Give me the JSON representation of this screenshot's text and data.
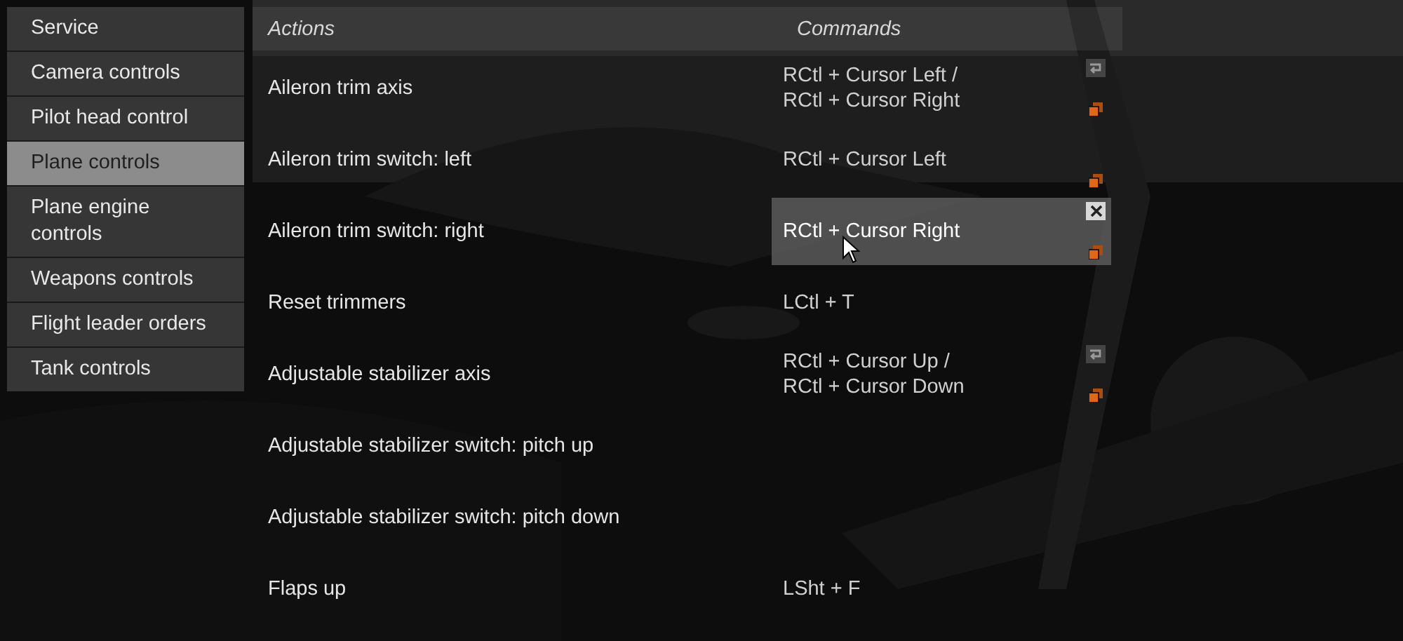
{
  "sidebar": {
    "items": [
      {
        "label": "Service",
        "selected": false
      },
      {
        "label": "Camera controls",
        "selected": false
      },
      {
        "label": "Pilot head control",
        "selected": false
      },
      {
        "label": "Plane controls",
        "selected": true
      },
      {
        "label": "Plane engine controls",
        "selected": false
      },
      {
        "label": "Weapons controls",
        "selected": false
      },
      {
        "label": "Flight leader orders",
        "selected": false
      },
      {
        "label": "Tank controls",
        "selected": false
      }
    ]
  },
  "table": {
    "columns": [
      "Actions",
      "Commands"
    ],
    "rows": [
      {
        "action": "Aileron trim axis",
        "command": "RCtl + Cursor Left /\nRCtl + Cursor Right",
        "axis": true,
        "copy": true,
        "hovered": false
      },
      {
        "action": "Aileron trim switch: left",
        "command": "RCtl + Cursor Left",
        "axis": false,
        "copy": true,
        "hovered": false
      },
      {
        "action": "Aileron trim switch: right",
        "command": "RCtl + Cursor Right",
        "axis": false,
        "copy": true,
        "hovered": true
      },
      {
        "action": "Reset trimmers",
        "command": "LCtl + T",
        "axis": false,
        "copy": false,
        "hovered": false
      },
      {
        "action": "Adjustable stabilizer axis",
        "command": "RCtl + Cursor Up /\nRCtl + Cursor Down",
        "axis": true,
        "copy": true,
        "hovered": false
      },
      {
        "action": "Adjustable stabilizer switch: pitch up",
        "axis": false,
        "copy": false,
        "hovered": false
      },
      {
        "action": "Adjustable stabilizer switch: pitch down",
        "axis": false,
        "copy": false,
        "hovered": false
      },
      {
        "action": "Flaps up",
        "command": "LSht + F",
        "axis": false,
        "copy": false,
        "hovered": false
      }
    ]
  }
}
